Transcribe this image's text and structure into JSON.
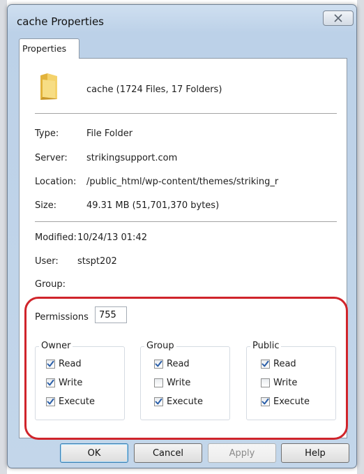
{
  "window": {
    "title": "cache Properties"
  },
  "tab": {
    "label": "Properties"
  },
  "summary": "cache (1724 Files, 17 Folders)",
  "details": [
    {
      "label": "Type:",
      "value": "File Folder"
    },
    {
      "label": "Server:",
      "value": "strikingsupport.com"
    },
    {
      "label": "Location:",
      "value": "/public_html/wp-content/themes/striking_r"
    },
    {
      "label": "Size:",
      "value": "49.31 MB (51,701,370 bytes)"
    }
  ],
  "meta": [
    {
      "label": "Modified:",
      "value": "10/24/13 01:42"
    },
    {
      "label": "User:",
      "value": "stspt202"
    },
    {
      "label": "Group:",
      "value": ""
    }
  ],
  "permissions": {
    "label": "Permissions",
    "value": "755",
    "groups": [
      {
        "title": "Owner",
        "items": [
          {
            "label": "Read",
            "checked": true
          },
          {
            "label": "Write",
            "checked": true
          },
          {
            "label": "Execute",
            "checked": true
          }
        ]
      },
      {
        "title": "Group",
        "items": [
          {
            "label": "Read",
            "checked": true
          },
          {
            "label": "Write",
            "checked": false
          },
          {
            "label": "Execute",
            "checked": true
          }
        ]
      },
      {
        "title": "Public",
        "items": [
          {
            "label": "Read",
            "checked": true
          },
          {
            "label": "Write",
            "checked": false
          },
          {
            "label": "Execute",
            "checked": true
          }
        ]
      }
    ]
  },
  "buttons": {
    "ok": "OK",
    "cancel": "Cancel",
    "apply": "Apply",
    "help": "Help"
  },
  "colors": {
    "highlight": "#d0242b",
    "check": "#2a5ea8"
  },
  "icons": {
    "close": "close-icon",
    "folder": "folder-icon",
    "check": "checkmark-icon"
  }
}
